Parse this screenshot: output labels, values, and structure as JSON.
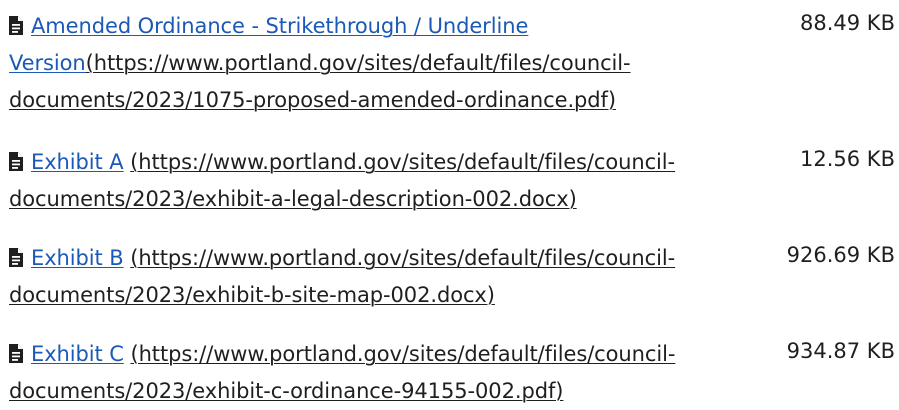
{
  "files": [
    {
      "name": "Amended Ordinance - Strikethrough / Underline Version",
      "url_line_1": "(https://www.portland.gov/sites/default/files/council-",
      "url_line_2": "documents/2023/1075-proposed-amended-ordinance.pdf)",
      "size": "88.49 KB",
      "icon": "file-icon"
    },
    {
      "name": "Exhibit A",
      "url_line_1": "(https://www.portland.gov/sites/default/files/council-",
      "url_line_2": "documents/2023/exhibit-a-legal-description-002.docx)",
      "size": "12.56 KB",
      "icon": "file-icon"
    },
    {
      "name": "Exhibit B",
      "url_line_1": "(https://www.portland.gov/sites/default/files/council-",
      "url_line_2": "documents/2023/exhibit-b-site-map-002.docx)",
      "size": "926.69 KB",
      "icon": "file-icon"
    },
    {
      "name": "Exhibit C",
      "url_line_1": "(https://www.portland.gov/sites/default/files/council-",
      "url_line_2": "documents/2023/exhibit-c-ordinance-94155-002.pdf)",
      "size": "934.87 KB",
      "icon": "file-icon"
    }
  ],
  "colors": {
    "link": "#1b59b6",
    "text": "#1f1f1f",
    "background": "#ffffff"
  }
}
